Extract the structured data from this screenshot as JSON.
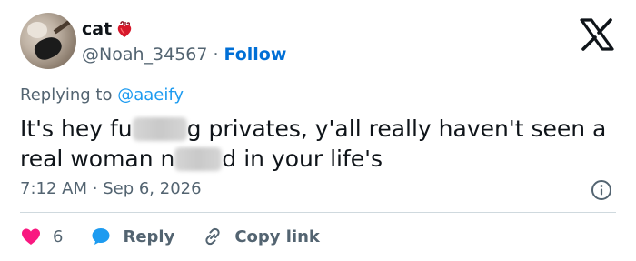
{
  "author": {
    "display_name": "cat",
    "badge": "anatomical-heart-icon",
    "handle": "@Noah_34567",
    "follow_label": "Follow"
  },
  "replying": {
    "prefix": "Replying to",
    "mention": "@aaeify"
  },
  "tweet": {
    "line1_a": "It's hey fu",
    "line1_b": "g privates, y'all really haven't seen a",
    "line2_a": "real woman n",
    "line2_b": "d in your life's"
  },
  "meta": {
    "time": "7:12 AM",
    "separator": "·",
    "date": "Sep 6, 2026"
  },
  "actions": {
    "like_count": "6",
    "reply_label": "Reply",
    "copy_label": "Copy link"
  },
  "colors": {
    "accent": "#1d9bf0",
    "follow": "#006fd6",
    "like": "#f91880",
    "muted": "#536471"
  }
}
